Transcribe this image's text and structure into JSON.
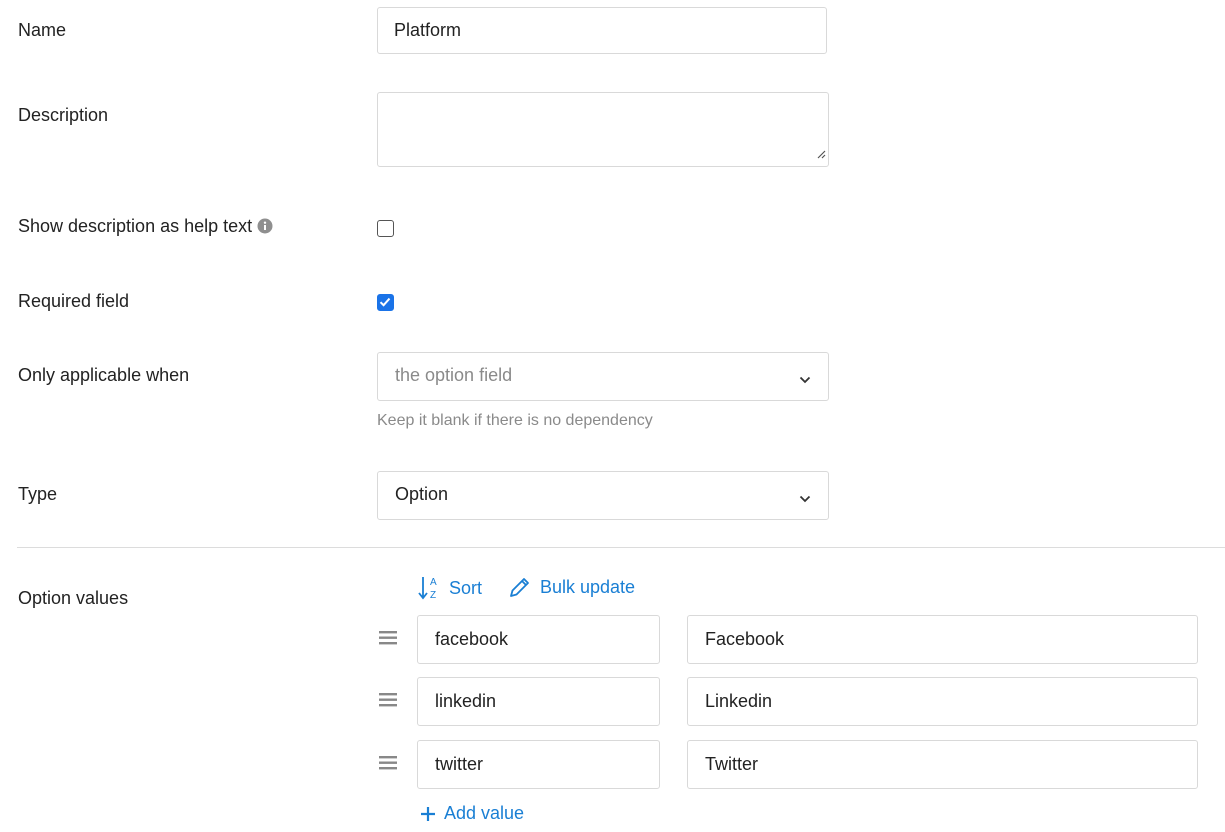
{
  "fields": {
    "name": {
      "label": "Name",
      "value": "Platform"
    },
    "description": {
      "label": "Description",
      "value": ""
    },
    "show_description": {
      "label": "Show description as help text",
      "checked": false
    },
    "required": {
      "label": "Required field",
      "checked": true
    },
    "applicable": {
      "label": "Only applicable when",
      "placeholder": "the option field",
      "hint": "Keep it blank if there is no dependency"
    },
    "type": {
      "label": "Type",
      "value": "Option"
    }
  },
  "option_values": {
    "label": "Option values",
    "sort_label": "Sort",
    "bulk_label": "Bulk update",
    "add_label": "Add value",
    "items": [
      {
        "key": "facebook",
        "label": "Facebook"
      },
      {
        "key": "linkedin",
        "label": "Linkedin"
      },
      {
        "key": "twitter",
        "label": "Twitter"
      }
    ]
  },
  "colors": {
    "accent": "#1a7fd4",
    "checkbox": "#1a73e8"
  },
  "icons": [
    "info-icon",
    "chevron-down-icon",
    "sort-az-icon",
    "pencil-icon",
    "drag-handle-icon",
    "plus-icon",
    "resize-handle-icon"
  ]
}
